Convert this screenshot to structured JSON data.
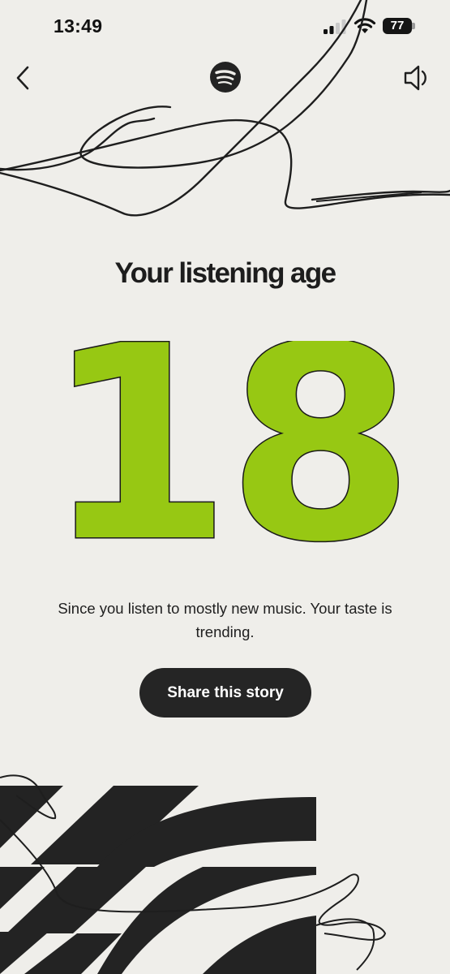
{
  "status_bar": {
    "time": "13:49",
    "battery_level": "77",
    "icons": [
      "signal-icon",
      "wifi-icon",
      "battery-icon"
    ]
  },
  "nav": {
    "back_icon": "chevron-left-icon",
    "logo_icon": "spotify-logo-icon",
    "sound_icon": "speaker-icon"
  },
  "story": {
    "headline": "Your listening age",
    "age": "18",
    "caption": "Since you listen to mostly new music. Your taste is trending.",
    "share_label": "Share this story"
  },
  "colors": {
    "background": "#efeeea",
    "accent_green": "#97c813",
    "dark": "#252525"
  }
}
